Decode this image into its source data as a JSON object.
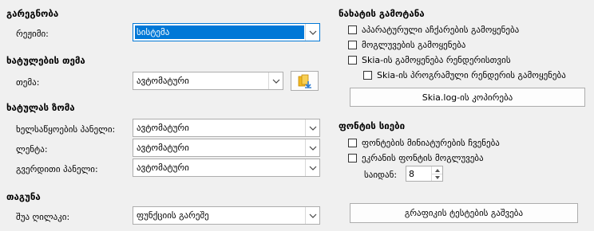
{
  "size": {
    "title": "გარეგნობა",
    "mode_label": "რეჟიმი:",
    "mode_value": "სისტემა"
  },
  "icon_theme": {
    "title": "ხატულების თემა",
    "theme_label": "თემა:",
    "theme_value": "ავტომატური",
    "extension_icon": "add-icon-theme-icon"
  },
  "icon_size": {
    "title": "ხატულას ზომა",
    "toolbar_label": "ხელსაწყოების პანელი:",
    "toolbar_value": "ავტომატური",
    "notebookbar_label": "ლენტა:",
    "notebookbar_value": "ავტომატური",
    "sidebar_label": "გვერდითი პანელი:",
    "sidebar_value": "ავტომატური"
  },
  "mouse": {
    "title": "თაგუნა",
    "middle_label": "შუა ღილაკი:",
    "middle_value": "ფუნქციის გარეშე"
  },
  "graphics_output": {
    "title": "ნახატის გამოტანა",
    "hw_accel": "აპარატურული აჩქარების გამოყენება",
    "antialias": "მოგლუვების გამოყენება",
    "skia": "Skia-ის გამოყენება რენდერისთვის",
    "skia_software": "Skia-ის პროგრამული რენდერის გამოყენება",
    "copy_log_button": "Skia.log-ის კოპირება"
  },
  "font_lists": {
    "title": "ფონტის სიები",
    "show_preview": "ფონტების მინიატურების ჩვენება",
    "screen_antialias": "ეკრანის ფონტის მოგლუვება",
    "from_label": "საიდან:",
    "from_value": "8"
  },
  "run_tests_button": "გრაფიკის ტესტების გაშვება",
  "colors": {
    "accent": "#0078d7",
    "icon_yellow": "#f2b91f",
    "icon_blue": "#2a7ad3"
  }
}
